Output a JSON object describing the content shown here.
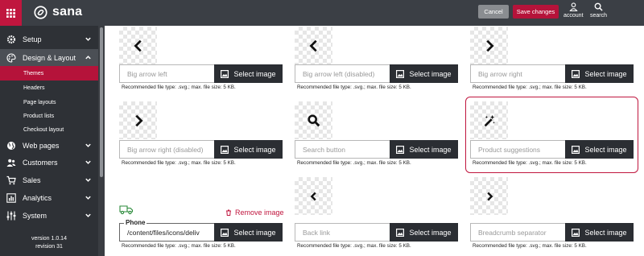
{
  "header": {
    "logo_text": "sana",
    "cancel_label": "Cancel",
    "save_label": "Save changes",
    "account_label": "account",
    "search_label": "search"
  },
  "sidebar": {
    "items": [
      {
        "label": "Setup",
        "icon": "gear-icon"
      },
      {
        "label": "Design & Layout",
        "icon": "palette-icon"
      },
      {
        "label": "Web pages",
        "icon": "globe-icon"
      },
      {
        "label": "Customers",
        "icon": "users-icon"
      },
      {
        "label": "Sales",
        "icon": "cart-icon"
      },
      {
        "label": "Analytics",
        "icon": "chart-icon"
      },
      {
        "label": "System",
        "icon": "sliders-icon"
      }
    ],
    "sub_items": [
      "Themes",
      "Headers",
      "Page layouts",
      "Product lists",
      "Checkout layout"
    ],
    "version_line1": "version 1.0.14",
    "version_line2": "revision 31"
  },
  "content": {
    "select_label": "Select image",
    "hint": "Recommended file type: .svg.; max. file size: 5 KB.",
    "fields": [
      {
        "placeholder": "Big arrow left",
        "icon": "chevron-left-icon"
      },
      {
        "placeholder": "Big arrow left (disabled)",
        "icon": "chevron-left-icon"
      },
      {
        "placeholder": "Big arrow right",
        "icon": "chevron-right-icon"
      },
      {
        "placeholder": "Big arrow right (disabled)",
        "icon": "chevron-right-icon"
      },
      {
        "placeholder": "Search button",
        "icon": "magnifier-icon"
      },
      {
        "placeholder": "Product suggestions",
        "icon": "magic-wand-icon"
      },
      {
        "label": "Phone",
        "value": "/content/files/icons/deliv",
        "icon": "delivery-truck-icon"
      },
      {
        "placeholder": "Back link",
        "icon": "chevron-left-icon"
      },
      {
        "placeholder": "Breadcrumb separator",
        "icon": "chevron-right-icon"
      }
    ],
    "remove_label": "Remove image",
    "accent_color": "#c0163e"
  }
}
